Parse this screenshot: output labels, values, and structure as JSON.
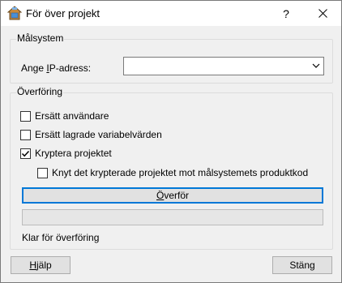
{
  "window": {
    "title": "För över projekt",
    "help_glyph": "?",
    "close_icon": "close-icon"
  },
  "target_group": {
    "title": "Målsystem",
    "ip_label_prefix": "Ange ",
    "ip_label_mnemonic": "I",
    "ip_label_suffix": "P-adress:",
    "ip_value": ""
  },
  "transfer_group": {
    "title": "Överföring",
    "options": {
      "replace_users": {
        "label": "Ersätt användare",
        "checked": false
      },
      "replace_values": {
        "label": "Ersätt lagrade variabelvärden",
        "checked": false
      },
      "encrypt": {
        "label": "Kryptera projektet",
        "checked": true
      },
      "bind": {
        "label": "Knyt det krypterade projektet mot målsystemets produktkod",
        "checked": false
      }
    },
    "transfer_button_mnemonic": "Ö",
    "transfer_button_rest": "verför",
    "progress": 0,
    "status": "Klar för överföring"
  },
  "footer": {
    "help_mnemonic": "H",
    "help_rest": "jälp",
    "close_label": "Stäng"
  }
}
